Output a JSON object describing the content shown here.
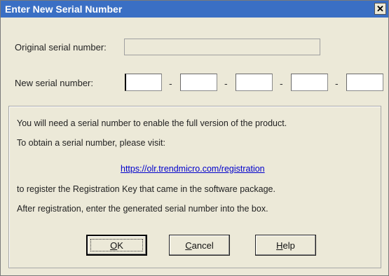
{
  "window": {
    "title": "Enter New Serial Number",
    "close_glyph": "✕"
  },
  "form": {
    "original_label": "Original serial number:",
    "original_value": "",
    "new_label": "New serial number:",
    "segments": [
      "",
      "",
      "",
      "",
      ""
    ],
    "separator": "-"
  },
  "info": {
    "line1": "You will need a serial number to enable the full version of the product.",
    "line2": "To obtain a serial number, please visit:",
    "link": "https://olr.trendmicro.com/registration",
    "line3": "to register the Registration Key that came in the software package.",
    "line4": "After registration, enter the generated serial number into the box."
  },
  "buttons": {
    "ok": {
      "mnemonic": "O",
      "rest": "K"
    },
    "cancel": {
      "mnemonic": "C",
      "rest": "ancel"
    },
    "help": {
      "mnemonic": "H",
      "rest": "elp"
    }
  }
}
